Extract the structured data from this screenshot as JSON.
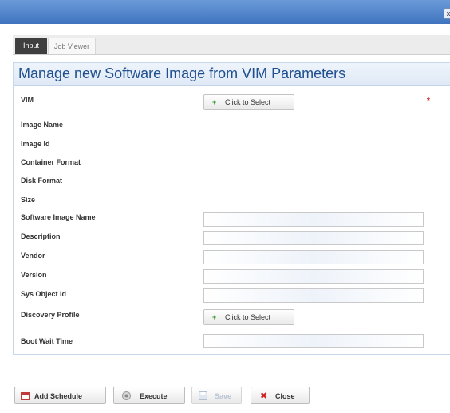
{
  "window": {
    "close_glyph": "x"
  },
  "tabs": [
    {
      "label": "Input",
      "active": true
    },
    {
      "label": "Job Viewer",
      "active": false
    }
  ],
  "form": {
    "title": "Manage new Software Image from VIM Parameters",
    "required_marker": "*",
    "select_label": "Click to Select",
    "fields": {
      "vim": "VIM",
      "image_name": "Image Name",
      "image_id": "Image Id",
      "container_format": "Container Format",
      "disk_format": "Disk Format",
      "size": "Size",
      "software_image_name": "Software Image Name",
      "description": "Description",
      "vendor": "Vendor",
      "version": "Version",
      "sys_object_id": "Sys Object Id",
      "discovery_profile": "Discovery Profile",
      "boot_wait_time": "Boot Wait Time"
    },
    "values": {
      "software_image_name": "",
      "description": "",
      "vendor": "",
      "version": "",
      "sys_object_id": "",
      "boot_wait_time": ""
    }
  },
  "buttons": {
    "add_schedule": "Add Schedule",
    "execute": "Execute",
    "save": "Save",
    "close": "Close"
  },
  "icons": {
    "plus": "plus-icon",
    "calendar": "calendar-icon",
    "execute": "execute-icon",
    "save": "floppy-disk-icon",
    "close": "close-x-icon"
  },
  "colors": {
    "titlebar": "#4a7fc8",
    "panel_title": "#1f4f8f",
    "required": "#d02020",
    "plus": "#3aa03a",
    "close_x": "#d02020"
  }
}
